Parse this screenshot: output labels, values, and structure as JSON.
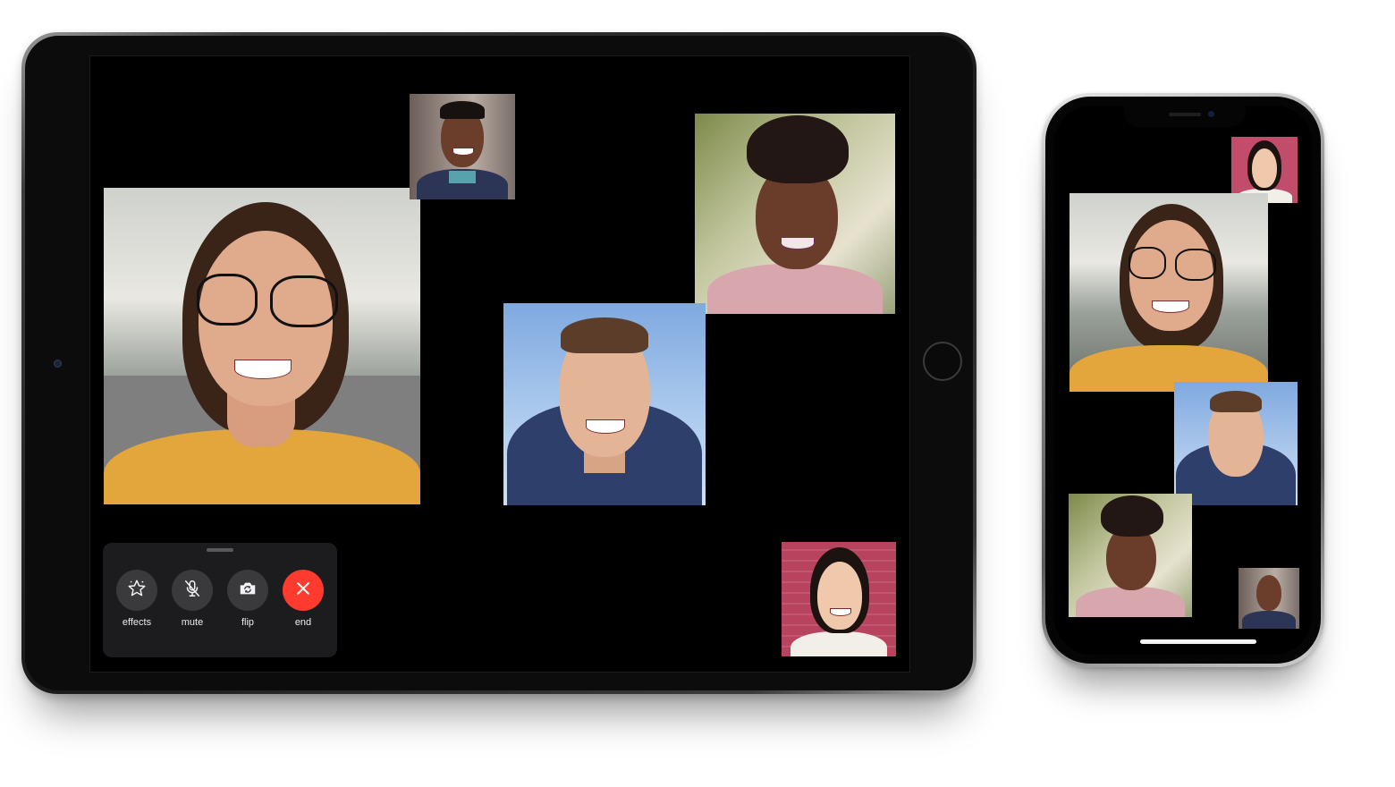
{
  "controls": {
    "effects_label": "effects",
    "mute_label": "mute",
    "flip_label": "flip",
    "end_label": "end"
  },
  "icons": {
    "effects": "star-icon",
    "mute": "microphone-slash-icon",
    "flip": "camera-flip-icon",
    "end": "close-icon"
  },
  "colors": {
    "end_button": "#ff3b30",
    "control_button": "#3a3a3c",
    "panel": "#1c1c1e",
    "screen": "#000000"
  },
  "participants": [
    {
      "id": "woman-glasses",
      "tile_bg": "#d8d8d4",
      "skin": "#e0aa8d",
      "hair": "#3a2418",
      "shirt": "#e2a63c"
    },
    {
      "id": "man-dark-top",
      "tile_bg": "#8a7d79",
      "skin": "#6a3e2b",
      "hair": "#171110",
      "shirt": "#2d3556"
    },
    {
      "id": "woman-curly",
      "tile_bg": "#b8bf92",
      "skin": "#6a3d2a",
      "hair": "#221714",
      "shirt": "#d7a7ad"
    },
    {
      "id": "young-man",
      "tile_bg": "#9dc0ea",
      "skin": "#e3b496",
      "hair": "#5b3d29",
      "shirt": "#2e3f6c"
    },
    {
      "id": "woman-pink",
      "tile_bg": "#c24d6a",
      "skin": "#f0c9ad",
      "hair": "#1c1310",
      "shirt": "#f2efe9"
    }
  ]
}
